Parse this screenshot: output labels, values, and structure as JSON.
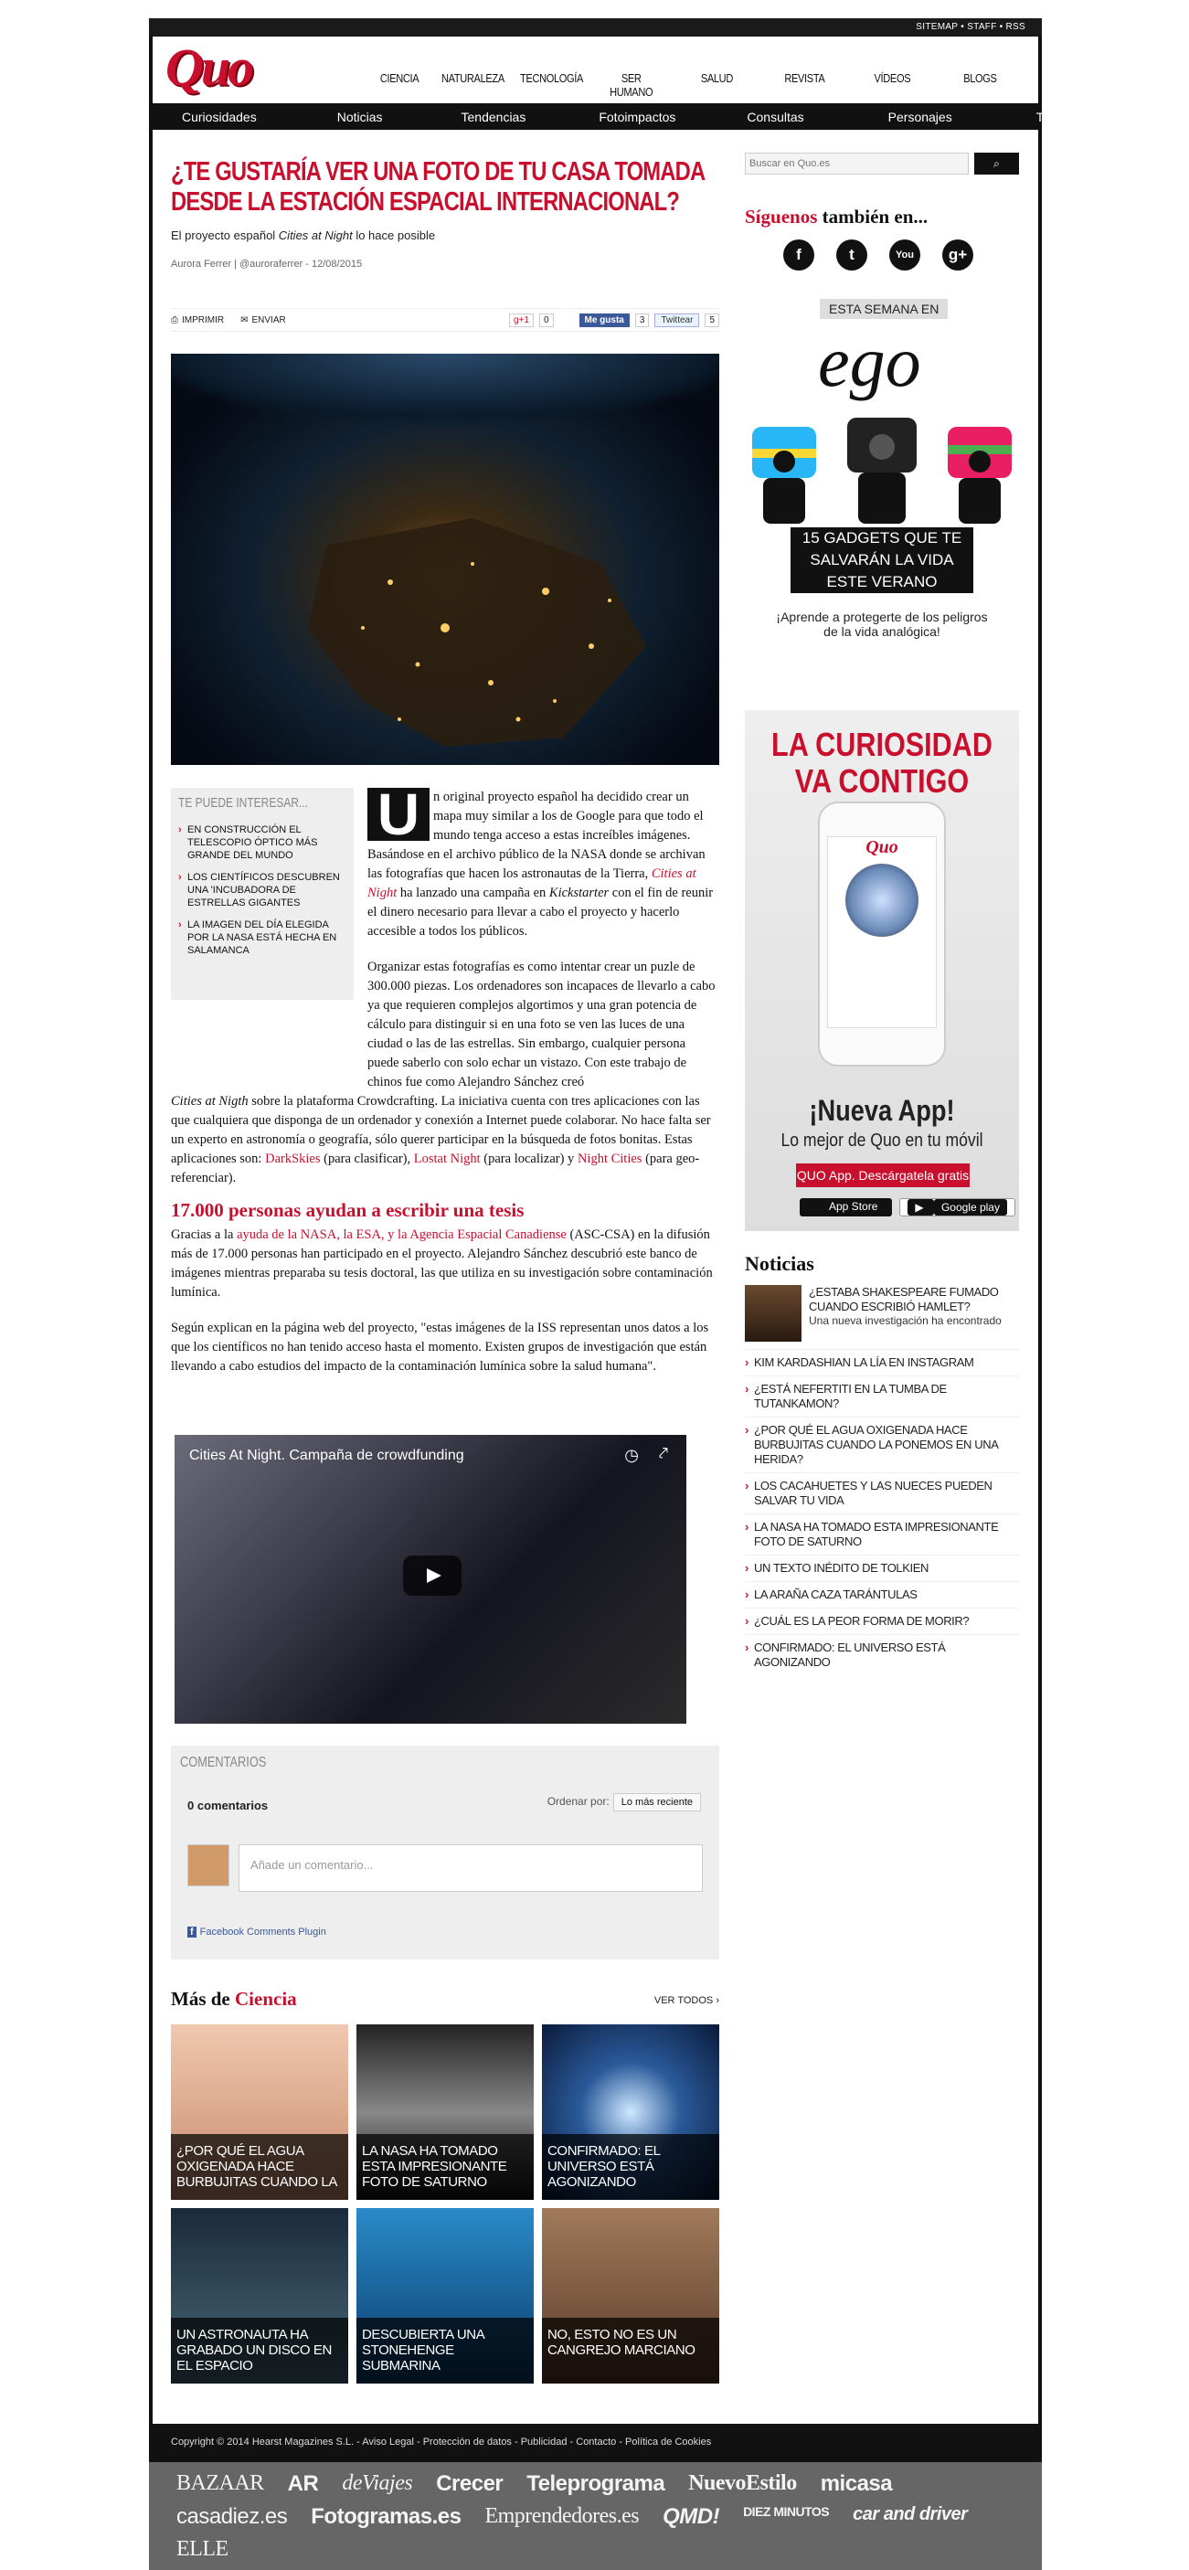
{
  "topbar": {
    "sitemap": "SITEMAP",
    "staff": "STAFF",
    "rss": "RSS"
  },
  "logo": "Quo",
  "mainnav": [
    {
      "label": "CIENCIA",
      "color": "#c8102e"
    },
    {
      "label": "NATURALEZA",
      "color": "#8bc34a"
    },
    {
      "label": "TECNOLOGÍA",
      "color": "#2196f3"
    },
    {
      "label": "SER HUMANO",
      "color": "#f44336"
    },
    {
      "label": "SALUD",
      "color": "#4caf50"
    },
    {
      "label": "REVISTA",
      "color": "#ffeb3b"
    },
    {
      "label": "VÍDEOS",
      "color": "#673ab7"
    },
    {
      "label": "BLOGS",
      "color": "#bfb89a"
    }
  ],
  "subnav": [
    "Curiosidades",
    "Noticias",
    "Tendencias",
    "Fotoimpactos",
    "Consultas",
    "Personajes",
    "Trucos"
  ],
  "article": {
    "title": "¿Te gustaría ver una foto de tu casa tomada desde la Estación Espacial Internacional?",
    "subtitle_a": "El proyecto español ",
    "subtitle_em": "Cities at Night",
    "subtitle_b": " lo hace posible",
    "byline": "Aurora Ferrer | @auroraferrer - 12/08/2015",
    "print": "IMPRIMIR",
    "send": "ENVIAR",
    "gplus": "g+1",
    "gplus_count": "0",
    "fb": "Me gusta",
    "fb_count": "3",
    "tw": "Twittear",
    "tw_count": "5",
    "interest_title": "Te puede interesar...",
    "interest": [
      "En construcción el telescopio óptico más grande del mundo",
      "Los científicos descubren una 'incubadora de estrellas gigantes",
      "La imagen del día elegida por la NASA está hecha en Salamanca"
    ],
    "drop": "U",
    "p1_a": "n original proyecto español ha decidido crear un mapa muy similar a los de Google para que todo el mundo tenga acceso a estas increíbles imágenes. Basándose en el archivo público de la NASA donde se archivan las fotografías que hacen los astronautas de la Tierra, ",
    "p1_link": "Cities at Night",
    "p1_b": " ha lanzado una campaña en ",
    "p1_em": "Kickstarter",
    "p1_c": " con el fin de reunir el dinero necesario para llevar a cabo el proyecto y hacerlo accesible a todos los públicos.",
    "p2_a": "Organizar estas fotografías es como intentar crear un puzle de 300.000 piezas. Los ordenadores son incapaces de llevarlo a cabo ya que requieren complejos algortimos y una gran potencia de cálculo para distinguir si en una foto se ven las luces de una ciudad o las de las estrellas. Sin embargo, cualquier persona puede saberlo con solo echar un vistazo. Con este trabajo de chinos fue como Alejandro Sánchez creó ",
    "p2_em": "Cities at Nigth",
    "p2_b": " sobre la plataforma Crowdcrafting. La iniciativa cuenta con tres aplicaciones con las que cualquiera que disponga de un ordenador y conexión a Internet puede colaborar. No hace falta ser un experto en astronomía o geografía, sólo querer participar en la búsqueda de fotos bonitas. Estas aplicaciones son: ",
    "l1": "DarkSkies",
    "t1": " (para clasificar), ",
    "l2": "Lostat Night",
    "t2": " (para localizar) y ",
    "l3": "Night Cities",
    "t3": " (para geo-referenciar).",
    "h2": "17.000 personas ayudan a escribir una tesis",
    "p3_a": "Gracias a la ",
    "p3_link": "ayuda de la NASA, la ESA, y la Agencia Espacial Canadiense",
    "p3_b": " (ASC-CSA) en la difusión más de 17.000 personas han participado en el proyecto. Alejandro Sánchez descubrió este banco de imágenes mientras preparaba su tesis doctoral, las que utiliza en su investigación sobre contaminación lumínica.",
    "p4": "Según explican en la página web del proyecto, \"estas imágenes de la ISS representan unos datos a los que los científicos no han tenido acceso hasta el momento. Existen grupos de investigación que están llevando a cabo estudios del impacto de la contaminación lumínica sobre la salud humana\".",
    "video_title": "Cities At Night. Campaña de crowdfunding"
  },
  "comments": {
    "title": "Comentarios",
    "count": "0 comentarios",
    "order_label": "Ordenar por:",
    "order_value": "Lo más reciente",
    "placeholder": "Añade un comentario...",
    "plugin": "Facebook Comments Plugin"
  },
  "more": {
    "title_a": "Más de ",
    "title_b": "Ciencia",
    "see_all": "VER TODOS",
    "cards": [
      {
        "caption": "¿Por qué el agua oxigenada hace burbujitas cuando la",
        "bg": "linear-gradient(#f0c8b0,#c88a6a)"
      },
      {
        "caption": "La NASA ha tomado esta impresionante foto de Saturno",
        "bg": "linear-gradient(#222,#888 50%,#111)"
      },
      {
        "caption": "Confirmado: el universo está agonizando",
        "bg": "radial-gradient(#cfe8ff,#2a5a9a 40%,#0a1a3a)"
      },
      {
        "caption": "Un astronauta ha grabado un disco en el espacio",
        "bg": "linear-gradient(#1a2a3a,#4a6a7a)"
      },
      {
        "caption": "Descubierta una Stonehenge submarina",
        "bg": "linear-gradient(#2a8ac8,#0a3a6a)"
      },
      {
        "caption": "No, esto no es un cangrejo marciano",
        "bg": "linear-gradient(#a07a5a,#5a3a2a)"
      }
    ]
  },
  "sidebar": {
    "search_placeholder": "Buscar en Quo.es",
    "follow_a": "Síguenos",
    "follow_b": " también en...",
    "social": [
      "f",
      "t",
      "You",
      "g+"
    ],
    "ego_week": "ESTA SEMANA EN",
    "ego_logo": "ego",
    "ego_gadgets": "15 GADGETS QUE TE SALVARÁN LA VIDA ESTE VERANO",
    "ego_sub": "¡Aprende a protegerte de los peligros de la vida analógica!",
    "ad_title": "LA CURIOSIDAD VA CONTIGO",
    "ad_new": "¡Nueva App!",
    "ad_best": "Lo mejor de Quo en tu móvil",
    "ad_btn": "QUO App. Descárgatela gratis",
    "ad_appstore": "App Store",
    "ad_gplay": "Google play",
    "news_title": "Noticias",
    "news_feat_title": "¿Estaba Shakespeare fumado cuando escribió Hamlet?",
    "news_feat_desc": "Una nueva investigación ha encontrado",
    "news": [
      "Kim Kardashian la lía en Instagram",
      "¿Está Nefertiti en la tumba de Tutankamon?",
      "¿Por qué el agua oxigenada hace burbujitas cuando la ponemos en una herida?",
      "Los cacahuetes y las nueces pueden salvar tu vida",
      "La NASA ha tomado esta impresionante foto de Saturno",
      "Un texto inédito de Tolkien",
      "La araña caza tarántulas",
      "¿Cuál es la peor forma de morir?",
      "Confirmado: el universo está agonizando"
    ]
  },
  "footer": {
    "copy": "Copyright © 2014 Hearst Magazines S.L. - Aviso Legal - Protección de datos - Publicidad - Contacto - Política de Cookies",
    "brands": [
      "BAZAAR",
      "AR",
      "deViajes",
      "Crecer",
      "Teleprograma",
      "NuevoEstilo",
      "micasa",
      "casadiez.es",
      "Fotogramas.es",
      "Emprendedores.es",
      "QMD!",
      "DIEZ MINUTOS",
      "car and driver",
      "ELLE"
    ]
  }
}
